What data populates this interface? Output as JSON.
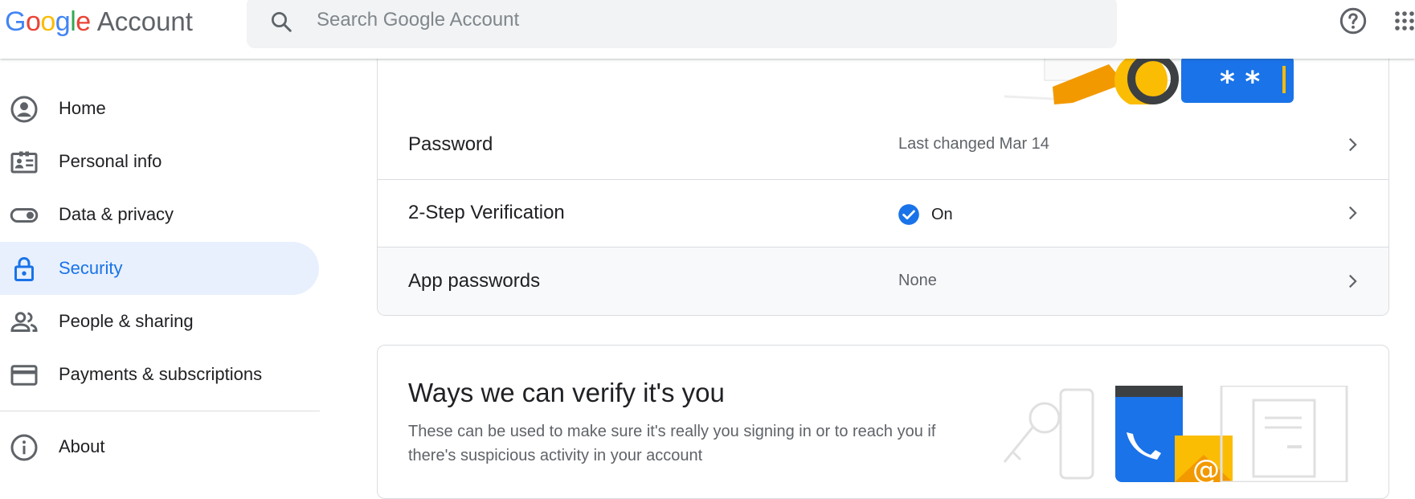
{
  "header": {
    "logo_google": "Google",
    "logo_account": "Account",
    "search_placeholder": "Search Google Account",
    "help_icon": "help-circle-icon",
    "apps_icon": "apps-grid-icon"
  },
  "sidebar": {
    "items": [
      {
        "label": "Home",
        "icon": "account-circle-icon",
        "active": false
      },
      {
        "label": "Personal info",
        "icon": "id-card-icon",
        "active": false
      },
      {
        "label": "Data & privacy",
        "icon": "toggle-icon",
        "active": false
      },
      {
        "label": "Security",
        "icon": "lock-icon",
        "active": true
      },
      {
        "label": "People & sharing",
        "icon": "people-icon",
        "active": false
      },
      {
        "label": "Payments & subscriptions",
        "icon": "credit-card-icon",
        "active": false
      },
      {
        "label": "About",
        "icon": "info-icon",
        "active": false
      }
    ]
  },
  "signin_card": {
    "illustration_text": "* *",
    "rows": [
      {
        "title": "Password",
        "value": "Last changed Mar 14"
      },
      {
        "title": "2-Step Verification",
        "value": "On"
      },
      {
        "title": "App passwords",
        "value": "None"
      }
    ]
  },
  "verify_card": {
    "title": "Ways we can verify it's you",
    "description": "These can be used to make sure it's really you signing in or to reach you if there's suspicious activity in your account"
  },
  "colors": {
    "accent": "#1a73e8",
    "active_bg": "#e8f0fe",
    "google_blue": "#4285F4",
    "google_red": "#EA4335",
    "google_yellow": "#FBBC05",
    "google_green": "#34A853"
  }
}
